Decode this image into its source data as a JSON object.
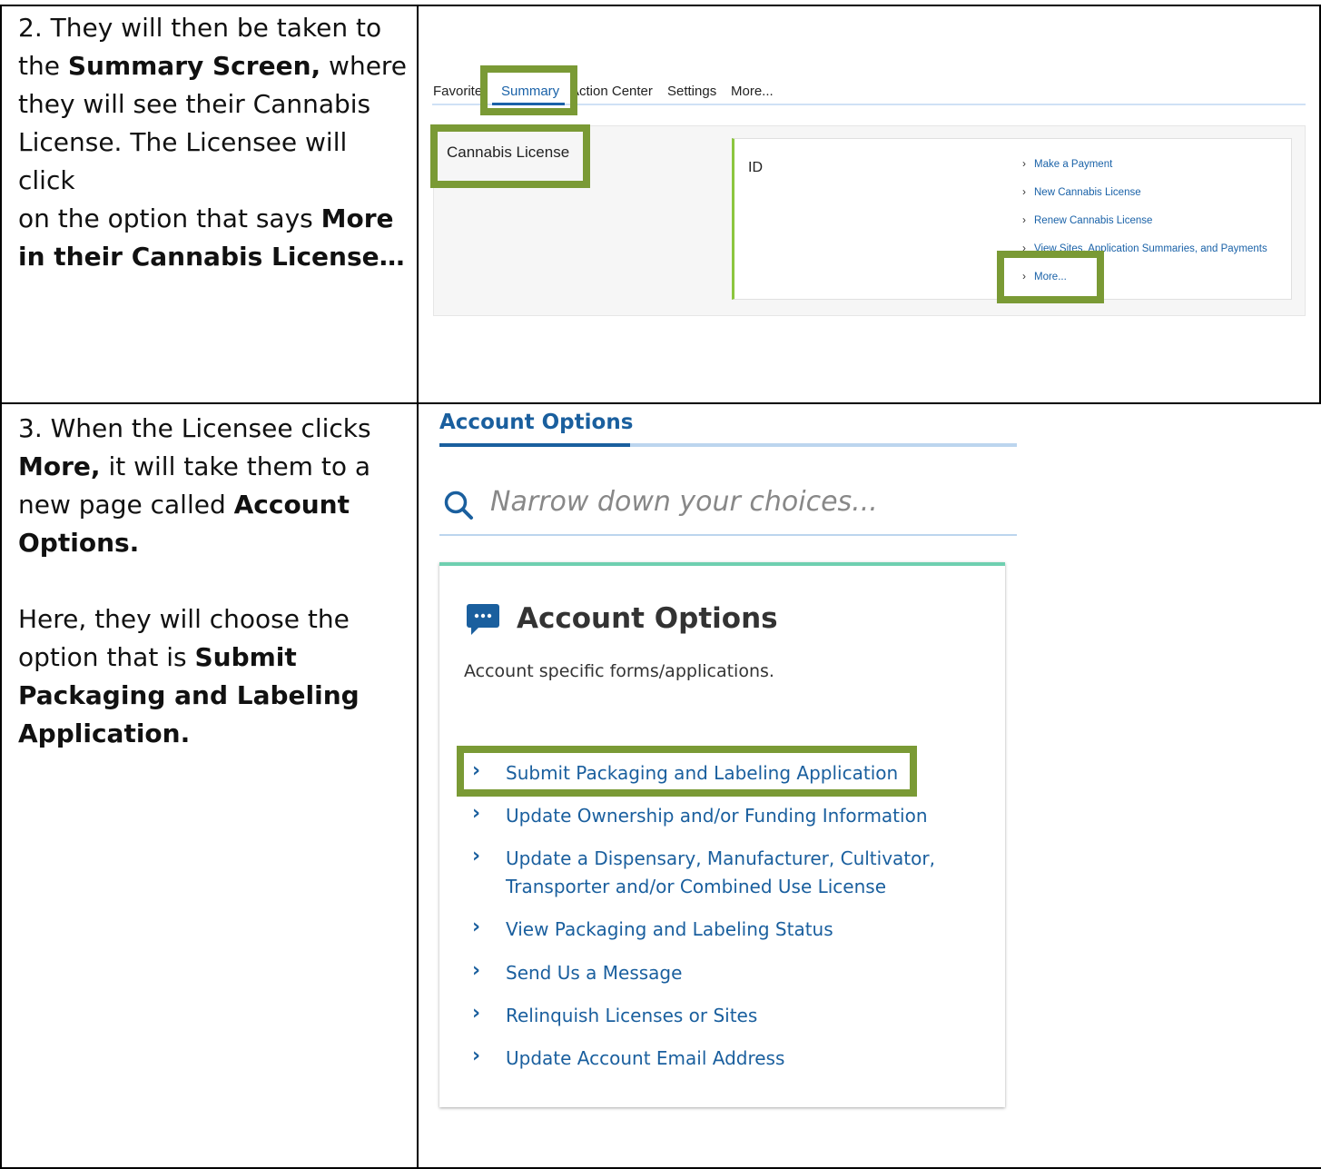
{
  "step2": {
    "line1": "2. They will then be taken to",
    "line2_pre": "the ",
    "line2_bold": "Summary Screen,",
    "line2_post": " where",
    "line3": "they will see their Cannabis",
    "line4": "License. The Licensee will click",
    "line5_pre": "on the option that says ",
    "line5_bold": "More",
    "line6_bold": "in their Cannabis License…"
  },
  "summary_screen": {
    "tabs": [
      "Favorite",
      "Summary",
      "Action Center",
      "Settings",
      "More..."
    ],
    "section_label": "Cannabis License",
    "card_id": "ID",
    "links": [
      "Make a Payment",
      "New Cannabis License",
      "Renew Cannabis License",
      "View Sites, Application Summaries, and Payments",
      "More..."
    ]
  },
  "step3": {
    "line1": "3. When the Licensee clicks",
    "line2_bold": "More,",
    "line2_post": " it will take them to a",
    "line3_pre": "new page called ",
    "line3_bold": "Account",
    "line4_bold": "Options.",
    "line5": "Here, they will choose the",
    "line6_pre": "option that is ",
    "line6_bold": "Submit",
    "line7_bold": "Packaging and Labeling",
    "line8_bold": "Application."
  },
  "account_options": {
    "tab_label": "Account Options",
    "search_placeholder": "Narrow down your choices...",
    "card_title": "Account Options",
    "card_subtitle": "Account specific forms/applications.",
    "links": [
      "Submit Packaging and Labeling Application",
      "Update Ownership and/or Funding Information",
      "Update a Dispensary, Manufacturer, Cultivator,",
      "Transporter and/or Combined Use License",
      "View Packaging and Labeling Status",
      "Send Us a Message",
      "Relinquish Licenses or Sites",
      "Update Account Email Address"
    ]
  },
  "colors": {
    "highlight": "#7a9a35",
    "link": "#1a5f9e",
    "accent_teal": "#6fcfb0"
  }
}
